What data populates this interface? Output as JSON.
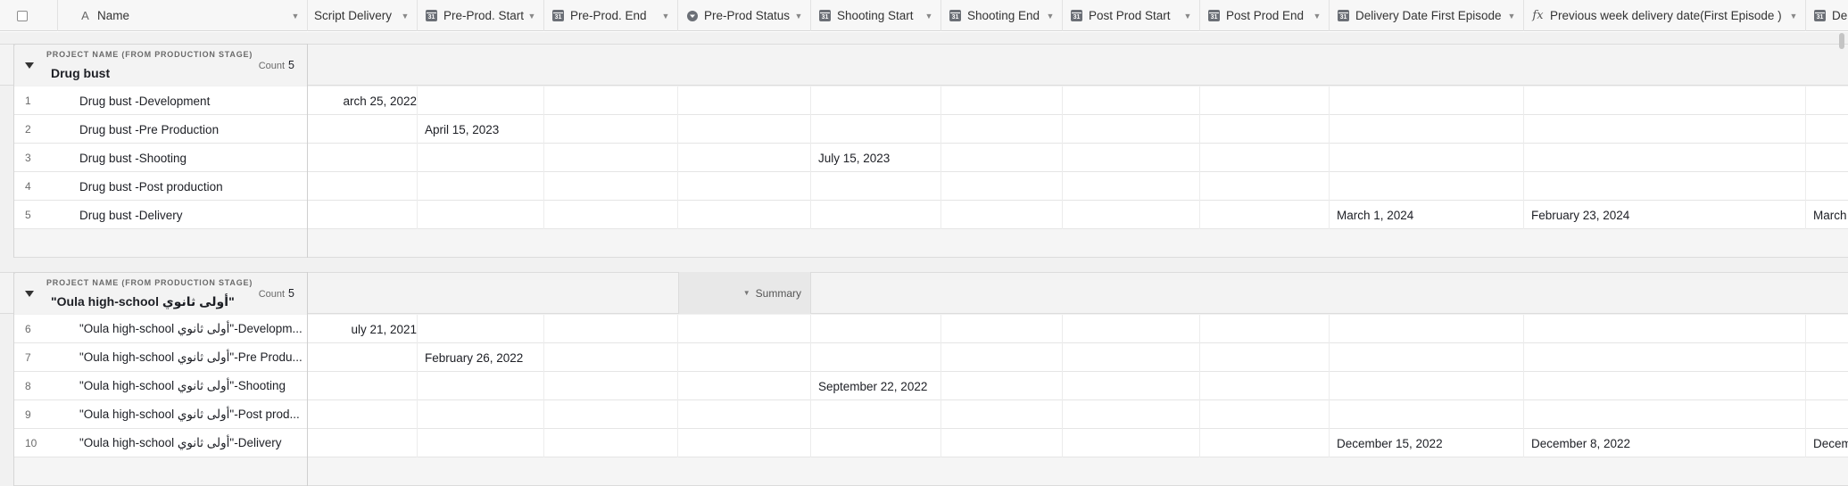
{
  "header": {
    "columns": [
      {
        "label": "Name",
        "icon": "text-icon"
      },
      {
        "label": "Script Delivery",
        "icon": "calendar-icon"
      },
      {
        "label": "Pre-Prod. Start",
        "icon": "calendar-icon"
      },
      {
        "label": "Pre-Prod. End",
        "icon": "calendar-icon"
      },
      {
        "label": "Pre-Prod Status",
        "icon": "single-select-icon"
      },
      {
        "label": "Shooting Start",
        "icon": "calendar-icon"
      },
      {
        "label": "Shooting End",
        "icon": "calendar-icon"
      },
      {
        "label": "Post Prod Start",
        "icon": "calendar-icon"
      },
      {
        "label": "Post Prod End",
        "icon": "calendar-icon"
      },
      {
        "label": "Delivery Date First Episode",
        "icon": "calendar-icon"
      },
      {
        "label": "Previous week delivery date(First Episode )",
        "icon": "formula-icon"
      },
      {
        "label": "Del",
        "icon": "calendar-icon"
      }
    ],
    "calendar_glyph": "31",
    "formula_glyph": "fx"
  },
  "groups": [
    {
      "caption": "PROJECT NAME (FROM PRODUCTION STAGE)",
      "title": "Drug bust",
      "count_label": "Count",
      "count": "5",
      "rows": [
        {
          "num": "1",
          "name": "Drug bust -Development",
          "script_delivery": "arch 25, 2022",
          "pre_prod_start": "",
          "shooting_start": "",
          "delivery_first": "",
          "prev_week": "",
          "del": ""
        },
        {
          "num": "2",
          "name": "Drug bust -Pre Production",
          "script_delivery": "",
          "pre_prod_start": "April 15, 2023",
          "shooting_start": "",
          "delivery_first": "",
          "prev_week": "",
          "del": ""
        },
        {
          "num": "3",
          "name": "Drug bust -Shooting",
          "script_delivery": "",
          "pre_prod_start": "",
          "shooting_start": "July 15, 2023",
          "delivery_first": "",
          "prev_week": "",
          "del": ""
        },
        {
          "num": "4",
          "name": "Drug bust -Post production",
          "script_delivery": "",
          "pre_prod_start": "",
          "shooting_start": "",
          "delivery_first": "",
          "prev_week": "",
          "del": ""
        },
        {
          "num": "5",
          "name": "Drug bust -Delivery",
          "script_delivery": "",
          "pre_prod_start": "",
          "shooting_start": "",
          "delivery_first": "March 1, 2024",
          "prev_week": "February 23, 2024",
          "del": "March"
        }
      ]
    },
    {
      "caption": "PROJECT NAME (FROM PRODUCTION STAGE)",
      "title": "\"Oula high-school أولى ثانوي\"",
      "count_label": "Count",
      "count": "5",
      "summary_label": "Summary",
      "rows": [
        {
          "num": "6",
          "name": "\"Oula high-school أولى ثانوي\"-Developm...",
          "script_delivery": "uly 21, 2021",
          "pre_prod_start": "",
          "shooting_start": "",
          "delivery_first": "",
          "prev_week": "",
          "del": ""
        },
        {
          "num": "7",
          "name": "\"Oula high-school أولى ثانوي\"-Pre Produ...",
          "script_delivery": "",
          "pre_prod_start": "February 26, 2022",
          "shooting_start": "",
          "delivery_first": "",
          "prev_week": "",
          "del": ""
        },
        {
          "num": "8",
          "name": "\"Oula high-school أولى ثانوي\"-Shooting",
          "script_delivery": "",
          "pre_prod_start": "",
          "shooting_start": "September 22, 2022",
          "delivery_first": "",
          "prev_week": "",
          "del": ""
        },
        {
          "num": "9",
          "name": "\"Oula high-school أولى ثانوي\"-Post prod...",
          "script_delivery": "",
          "pre_prod_start": "",
          "shooting_start": "",
          "delivery_first": "",
          "prev_week": "",
          "del": ""
        },
        {
          "num": "10",
          "name": "\"Oula high-school أولى ثانوي\"-Delivery",
          "script_delivery": "",
          "pre_prod_start": "",
          "shooting_start": "",
          "delivery_first": "December 15, 2022",
          "prev_week": "December 8, 2022",
          "del": "Decem"
        }
      ]
    }
  ]
}
